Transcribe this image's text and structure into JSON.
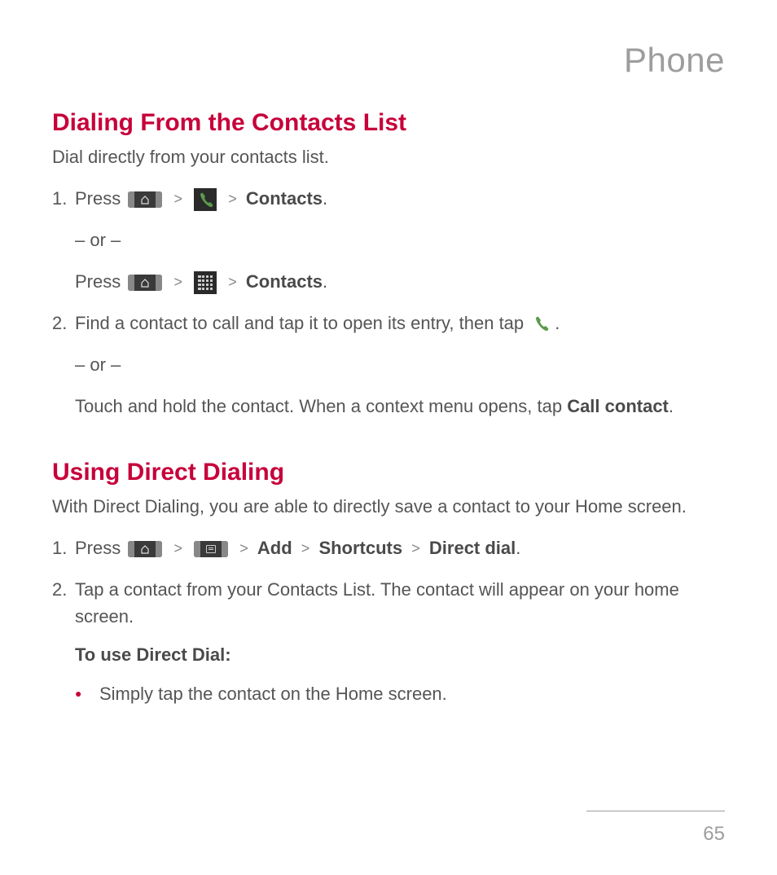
{
  "header": "Phone",
  "section1": {
    "title": "Dialing From the Contacts List",
    "intro": "Dial directly from your contacts list.",
    "step1": {
      "press": "Press",
      "contacts": "Contacts",
      "or": "– or –",
      "press2": "Press",
      "contacts2": "Contacts"
    },
    "step2": {
      "text": "Find a contact to call and tap it to open its entry, then tap",
      "period": ".",
      "or": "– or –",
      "text2a": "Touch and hold the contact. When a context menu opens, tap ",
      "text2b": "Call contact",
      "text2c": "."
    }
  },
  "section2": {
    "title": "Using Direct Dialing",
    "intro": "With Direct Dialing, you are able to directly save a contact to your Home screen.",
    "step1": {
      "press": "Press",
      "add": "Add",
      "shortcuts": "Shortcuts",
      "directdial": "Direct dial",
      "period": "."
    },
    "step2": "Tap a contact from your Contacts List. The contact will appear on your home screen.",
    "subheading": "To use Direct Dial:",
    "bullet1": "Simply tap the contact on the Home screen."
  },
  "pageNumber": "65"
}
